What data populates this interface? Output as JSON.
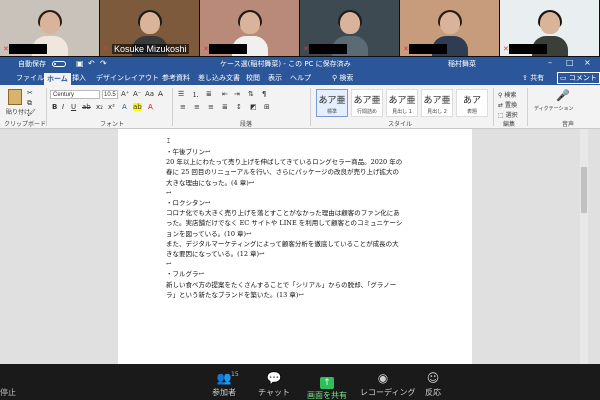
{
  "participants": [
    {
      "display_name": "",
      "bg": "#c9c2bb",
      "body": "#efe6dd",
      "hair": "#2b1d16",
      "active": false
    },
    {
      "display_name": "Kosuke Mizukoshi",
      "bg": "#7c5a3b",
      "body": "#3a3a3a",
      "hair": "#1b1b1b",
      "active": false
    },
    {
      "display_name": "",
      "bg": "#b98a7a",
      "body": "#f0f0f0",
      "hair": "#231915",
      "active": false
    },
    {
      "display_name": "",
      "bg": "#3d4a52",
      "body": "#5b6b73",
      "hair": "#1c1c1c",
      "active": false
    },
    {
      "display_name": "",
      "bg": "#c79c7d",
      "body": "#2f3d52",
      "hair": "#2a1c14",
      "active": false
    },
    {
      "display_name": "",
      "bg": "#e9eef0",
      "body": "#3a3f3a",
      "hair": "#1a1410",
      "active": true
    }
  ],
  "word": {
    "autosave_label": "自動保存",
    "doc_title": "ケース選(稲村舞菜) - この PC に保存済み",
    "user_name": "稲村舞菜",
    "tabs": [
      "ファイル",
      "ホーム",
      "挿入",
      "デザイン",
      "レイアウト",
      "参考資料",
      "差し込み文書",
      "校閲",
      "表示",
      "ヘルプ"
    ],
    "selected_tab": "ホーム",
    "search_label": "検索",
    "share_label": "共有",
    "comment_label": "コメント",
    "ribbon": {
      "paste_label": "貼り付け",
      "clipboard_label": "クリップボード",
      "font_name": "Century",
      "font_size": "10.5",
      "font_group_label": "フォント",
      "paragraph_group_label": "段落",
      "style_group_label": "スタイル",
      "styles": [
        {
          "sample": "あア亜",
          "name": "標準"
        },
        {
          "sample": "あア亜",
          "name": "行間詰め"
        },
        {
          "sample": "あア亜",
          "name": "見出し 1"
        },
        {
          "sample": "あア亜",
          "name": "見出し 2"
        },
        {
          "sample": "あア",
          "name": "表題"
        }
      ],
      "editing": {
        "find": "検索",
        "replace": "置換",
        "select": "選択"
      },
      "editing_group_label": "編集",
      "dictation_label": "ディクテーション",
      "voice_group_label": "音声"
    },
    "document_lines": [
      "・午後ブリン↩",
      "20 年以上にわたって売り上げを伸ばしてきているロングセラー商品。2020 年の",
      "春に 25 回目のリニューアルを行い、さらにパッケージの改良が売り上げ拡大の",
      "大きな理由になった。(4 章)↩",
      "↩",
      "・ロクシタン↩",
      "コロナ化でも大きく売り上げを落とすことがなかった理由は顧客のファン化にあ",
      "った。実店舗だけでなく EC サイトや LINE を利用して顧客とのコミュニケーシ",
      "ョンを図っている。(10 章)↩",
      "また、デジタルマーケティングによって顧客分析を徹底していることが成長の大",
      "きな要因になっている。(12 章)↩",
      "↩",
      "・フルグラ↩",
      "新しい食べ方の提案をたくさんすることで「シリアル」からの脱却、「グラノー",
      "ラ」という新たなブランドを築いた。(13 章)↩"
    ]
  },
  "zoom": {
    "left_label": "停止",
    "participants_label": "参加者",
    "participants_count": "15",
    "chat_label": "チャット",
    "share_label": "画面を共有",
    "record_label": "レコーディング",
    "reactions_label": "反応"
  }
}
